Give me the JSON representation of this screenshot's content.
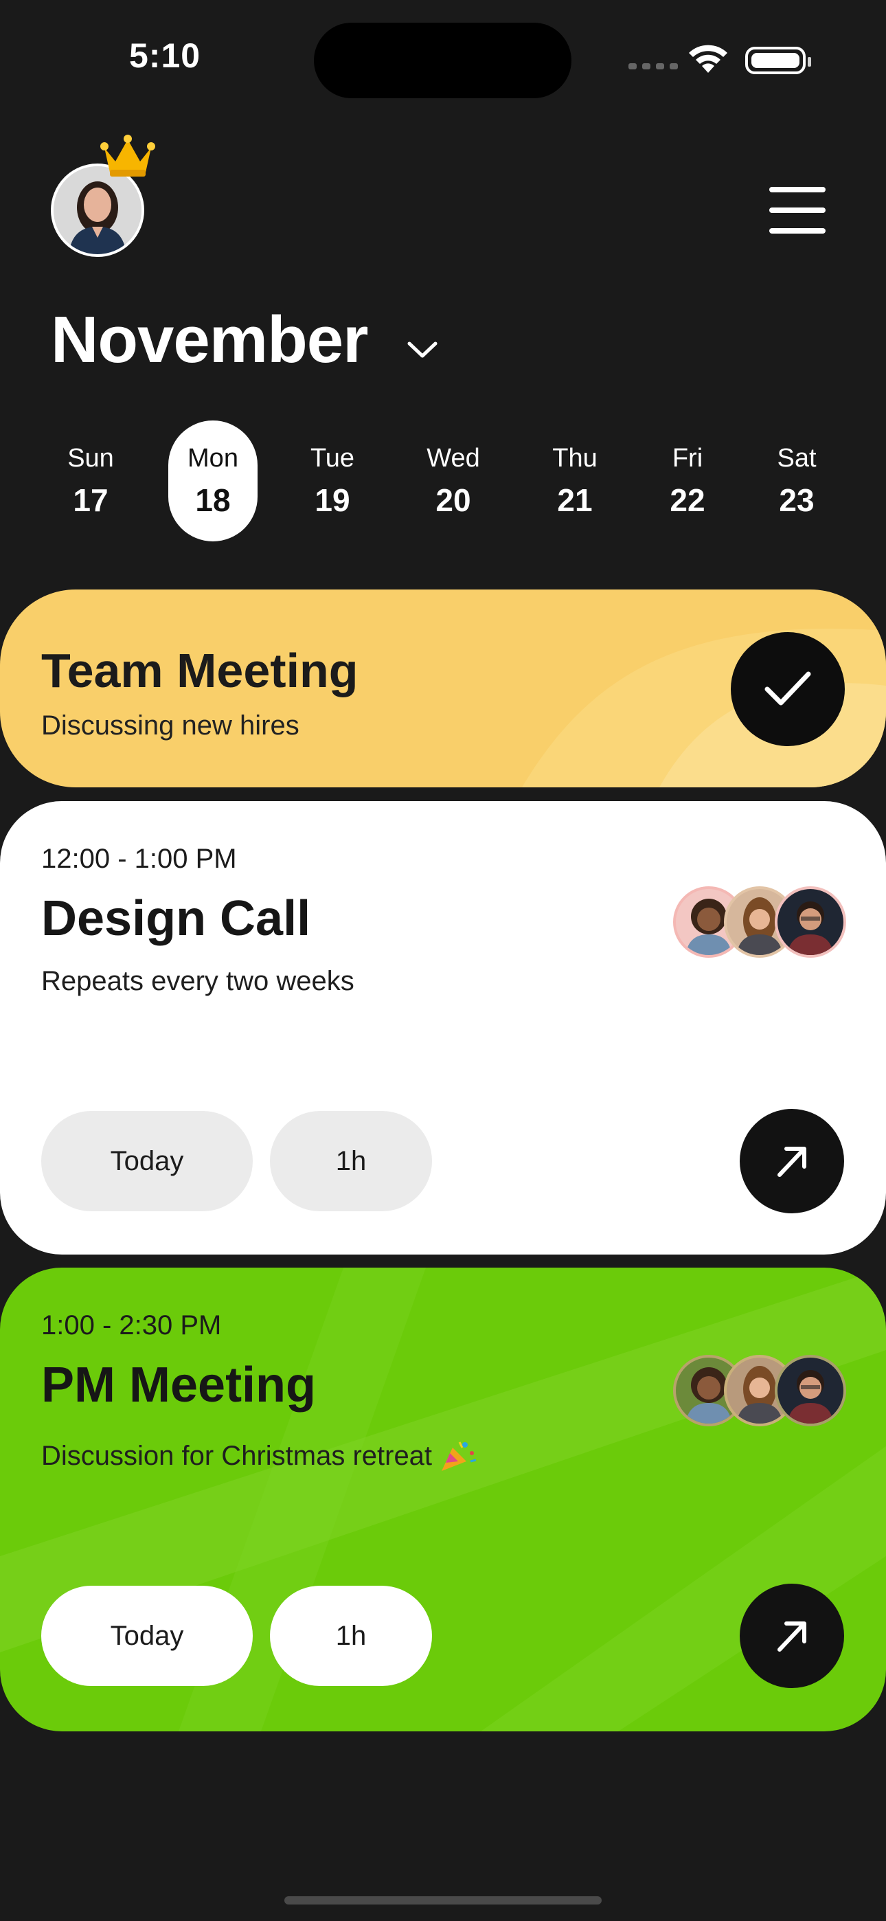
{
  "status": {
    "time": "5:10"
  },
  "header": {
    "month": "November"
  },
  "days": [
    {
      "name": "Sun",
      "num": "17"
    },
    {
      "name": "Mon",
      "num": "18"
    },
    {
      "name": "Tue",
      "num": "19"
    },
    {
      "name": "Wed",
      "num": "20"
    },
    {
      "name": "Thu",
      "num": "21"
    },
    {
      "name": "Fri",
      "num": "22"
    },
    {
      "name": "Sat",
      "num": "23"
    }
  ],
  "events": {
    "team": {
      "title": "Team Meeting",
      "subtitle": "Discussing new hires"
    },
    "design": {
      "time": "12:00 - 1:00 PM",
      "title": "Design Call",
      "subtitle": "Repeats every two weeks",
      "tag_day": "Today",
      "tag_duration": "1h"
    },
    "pm": {
      "time": "1:00 - 2:30 PM",
      "title": "PM Meeting",
      "subtitle": "Discussion for Christmas retreat",
      "tag_day": "Today",
      "tag_duration": "1h"
    }
  },
  "colors": {
    "background": "#1a1a1a",
    "team_card": "#f9cf6a",
    "pm_card": "#6bcb0a",
    "selected_day": "#ffffff"
  }
}
